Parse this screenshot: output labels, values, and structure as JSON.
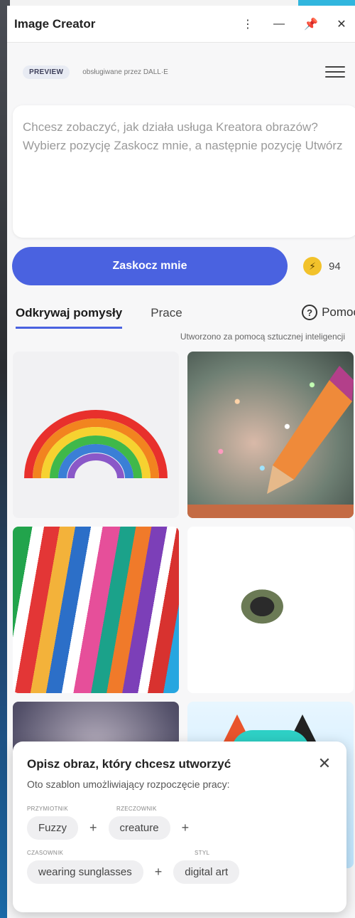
{
  "window": {
    "title": "Image Creator",
    "menu_glyph": "⋮",
    "minimize_glyph": "—",
    "pin_glyph": "📌",
    "close_glyph": "✕"
  },
  "header": {
    "badge": "PREVIEW",
    "powered_by": "obsługiwane przez DALL·E"
  },
  "prompt": {
    "placeholder": "Chcesz zobaczyć, jak działa usługa Kreatora obrazów? Wybierz pozycję Zaskocz mnie, a następnie pozycję Utwórz"
  },
  "actions": {
    "surprise_label": "Zaskocz mnie",
    "boost_count": "94",
    "boost_glyph": "⚡"
  },
  "tabs": {
    "explore": "Odkrywaj pomysły",
    "works": "Prace",
    "help": "Pomoc",
    "help_glyph": "?"
  },
  "ai_note": "Utworzono za pomocą sztucznej inteligencji",
  "colors": {
    "accent": "#4a62e0",
    "boost": "#f2c22b"
  },
  "popup": {
    "title": "Opisz obraz, który chcesz utworzyć",
    "subtitle": "Oto szablon umożliwiający rozpoczęcie pracy:",
    "close_glyph": "✕",
    "labels": {
      "adjective": "PRZYMIOTNIK",
      "noun": "RZECZOWNIK",
      "verb": "CZASOWNIK",
      "style": "STYL"
    },
    "chips": {
      "adjective": "Fuzzy",
      "noun": "creature",
      "verb": "wearing sunglasses",
      "style": "digital art"
    },
    "plus": "+"
  }
}
